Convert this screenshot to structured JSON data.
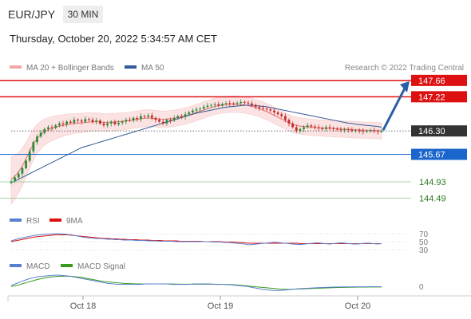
{
  "header": {
    "pair": "EUR/JPY",
    "timeframe": "30 MIN"
  },
  "datetime": "Thursday, October 20, 2022 5:34:57 AM CET",
  "legend": {
    "ma20": "MA 20 + Bollinger Bands",
    "ma50": "MA 50",
    "rsi": "RSI",
    "rsi_ma": "9MA",
    "macd": "MACD",
    "macd_signal": "MACD Signal"
  },
  "research": "Research © 2022 Trading Central",
  "colors": {
    "resistance": "#dd1111",
    "support": "#1a66cc",
    "target": "#2a7a20",
    "arrow": "#2a5fa8",
    "ma50": "#335a99",
    "ma20": "#e86f6f",
    "band_fill": "#fbe3e3",
    "rsi": "#5b7fd0",
    "rsi_ma": "#dd1111",
    "macd": "#5b7fd0",
    "macd_signal": "#3a9a20"
  },
  "chart_data": [
    {
      "type": "candlestick",
      "title": "EUR/JPY 30 MIN",
      "x_ticks": [
        "Oct 18",
        "Oct 19",
        "Oct 20"
      ],
      "ylim": [
        144.2,
        147.85
      ],
      "levels": [
        {
          "label": "147.66",
          "value": 147.66,
          "kind": "resistance"
        },
        {
          "label": "147.22",
          "value": 147.22,
          "kind": "resistance"
        },
        {
          "label": "146.30",
          "value": 146.3,
          "kind": "current"
        },
        {
          "label": "145.67",
          "value": 145.67,
          "kind": "support"
        },
        {
          "label": "144.93",
          "value": 144.93,
          "kind": "target"
        },
        {
          "label": "144.49",
          "value": 144.49,
          "kind": "target"
        }
      ],
      "close": [
        144.95,
        145.05,
        145.15,
        145.3,
        145.5,
        145.75,
        146.0,
        146.15,
        146.25,
        146.35,
        146.4,
        146.38,
        146.45,
        146.5,
        146.48,
        146.55,
        146.52,
        146.6,
        146.58,
        146.55,
        146.62,
        146.6,
        146.55,
        146.58,
        146.5,
        146.45,
        146.5,
        146.55,
        146.48,
        146.52,
        146.55,
        146.6,
        146.58,
        146.65,
        146.62,
        146.7,
        146.68,
        146.72,
        146.65,
        146.6,
        146.55,
        146.5,
        146.6,
        146.58,
        146.65,
        146.7,
        146.68,
        146.75,
        146.8,
        146.85,
        146.88,
        146.9,
        146.95,
        146.98,
        147.0,
        147.02,
        146.98,
        147.03,
        147.05,
        147.04,
        147.02,
        147.05,
        147.08,
        147.06,
        147.04,
        147.0,
        146.95,
        146.92,
        146.9,
        146.88,
        146.85,
        146.8,
        146.75,
        146.7,
        146.6,
        146.5,
        146.4,
        146.3,
        146.35,
        146.4,
        146.45,
        146.42,
        146.4,
        146.38,
        146.35,
        146.4,
        146.38,
        146.36,
        146.34,
        146.32,
        146.35,
        146.33,
        146.3,
        146.32,
        146.3,
        146.28,
        146.3,
        146.32,
        146.3,
        146.28,
        146.3
      ],
      "ma20": [
        145.0,
        145.08,
        145.2,
        145.35,
        145.55,
        145.75,
        145.95,
        146.1,
        146.2,
        146.28,
        146.33,
        146.37,
        146.4,
        146.43,
        146.45,
        146.47,
        146.49,
        146.5,
        146.51,
        146.52,
        146.53,
        146.54,
        146.54,
        146.55,
        146.54,
        146.53,
        146.53,
        146.54,
        146.54,
        146.55,
        146.56,
        146.57,
        146.58,
        146.6,
        146.61,
        146.63,
        146.64,
        146.65,
        146.64,
        146.63,
        146.62,
        146.61,
        146.62,
        146.63,
        146.64,
        146.66,
        146.68,
        146.7,
        146.73,
        146.76,
        146.8,
        146.83,
        146.86,
        146.9,
        146.93,
        146.96,
        146.98,
        147.0,
        147.01,
        147.02,
        147.02,
        147.02,
        147.01,
        147.0,
        146.98,
        146.96,
        146.93,
        146.9,
        146.86,
        146.82,
        146.77,
        146.72,
        146.67,
        146.62,
        146.57,
        146.52,
        146.48,
        146.45,
        146.43,
        146.42,
        146.41,
        146.4,
        146.39,
        146.38,
        146.38,
        146.37,
        146.37,
        146.36,
        146.36,
        146.35,
        146.35,
        146.34,
        146.34,
        146.33,
        146.33,
        146.32,
        146.32,
        146.31,
        146.31,
        146.31,
        146.3
      ],
      "ma50": [
        144.9,
        144.95,
        145.0,
        145.05,
        145.1,
        145.15,
        145.2,
        145.25,
        145.3,
        145.35,
        145.4,
        145.45,
        145.5,
        145.55,
        145.6,
        145.65,
        145.7,
        145.75,
        145.8,
        145.85,
        145.88,
        145.91,
        145.94,
        145.97,
        146.0,
        146.03,
        146.06,
        146.09,
        146.12,
        146.15,
        146.18,
        146.21,
        146.24,
        146.27,
        146.3,
        146.33,
        146.36,
        146.39,
        146.42,
        146.45,
        146.48,
        146.51,
        146.54,
        146.57,
        146.6,
        146.63,
        146.66,
        146.69,
        146.72,
        146.75,
        146.78,
        146.8,
        146.82,
        146.84,
        146.86,
        146.88,
        146.9,
        146.92,
        146.94,
        146.95,
        146.96,
        146.97,
        146.98,
        146.99,
        146.99,
        146.99,
        146.98,
        146.97,
        146.96,
        146.95,
        146.93,
        146.91,
        146.89,
        146.87,
        146.85,
        146.83,
        146.81,
        146.79,
        146.77,
        146.75,
        146.73,
        146.71,
        146.69,
        146.67,
        146.65,
        146.63,
        146.61,
        146.59,
        146.57,
        146.55,
        146.53,
        146.51,
        146.5,
        146.48,
        146.47,
        146.46,
        146.45,
        146.44,
        146.43,
        146.42,
        146.4
      ]
    },
    {
      "type": "line",
      "title": "RSI",
      "y_ticks": [
        "70",
        "50",
        "30"
      ],
      "ylim": [
        20,
        80
      ],
      "series": [
        {
          "name": "RSI",
          "values": [
            52,
            55,
            58,
            60,
            62,
            64,
            66,
            67,
            68,
            69,
            69,
            70,
            70,
            69,
            68,
            67,
            65,
            63,
            61,
            60,
            59,
            58,
            58,
            57,
            56,
            56,
            55,
            55,
            54,
            54,
            54,
            53,
            53,
            53,
            52,
            52,
            52,
            51,
            51,
            51,
            51,
            50,
            50,
            50,
            50,
            50,
            50,
            50,
            50,
            50,
            49,
            49,
            49,
            48,
            48,
            47,
            46,
            45,
            44,
            42,
            43,
            44,
            45,
            46,
            47,
            48,
            48,
            47,
            46,
            45,
            44,
            43,
            43,
            44,
            45,
            46,
            47,
            46,
            45,
            44,
            45,
            46,
            47,
            46,
            45,
            44,
            44,
            45,
            46,
            46,
            45,
            44,
            45
          ]
        },
        {
          "name": "9MA",
          "values": [
            50,
            52,
            54,
            56,
            58,
            60,
            62,
            63,
            64,
            65,
            66,
            67,
            67,
            67,
            67,
            66,
            65,
            64,
            63,
            62,
            61,
            60,
            59,
            58,
            58,
            57,
            57,
            56,
            56,
            55,
            55,
            55,
            54,
            54,
            54,
            53,
            53,
            53,
            52,
            52,
            52,
            52,
            51,
            51,
            51,
            51,
            51,
            51,
            50,
            50,
            50,
            50,
            50,
            49,
            49,
            49,
            48,
            48,
            47,
            46,
            46,
            46,
            46,
            46,
            46,
            46,
            46,
            46,
            46,
            46,
            46,
            46,
            45,
            45,
            45,
            45,
            45,
            45,
            45,
            45,
            45,
            45,
            45,
            45,
            45,
            45,
            45,
            45,
            45,
            45,
            45,
            45,
            45
          ]
        }
      ]
    },
    {
      "type": "line",
      "title": "MACD",
      "y_ticks": [
        "0"
      ],
      "ylim": [
        -0.1,
        0.15
      ],
      "series": [
        {
          "name": "MACD",
          "values": [
            0.01,
            0.03,
            0.05,
            0.07,
            0.085,
            0.095,
            0.1,
            0.105,
            0.11,
            0.11,
            0.105,
            0.1,
            0.09,
            0.08,
            0.07,
            0.06,
            0.05,
            0.04,
            0.03,
            0.025,
            0.02,
            0.02,
            0.02,
            0.02,
            0.02,
            0.025,
            0.025,
            0.025,
            0.025,
            0.025,
            0.02,
            0.02,
            0.02,
            0.02,
            0.025,
            0.025,
            0.025,
            0.025,
            0.02,
            0.02,
            0.02,
            0.015,
            0.01,
            0.005,
            0.0,
            -0.01,
            -0.02,
            -0.03,
            -0.035,
            -0.04,
            -0.04,
            -0.035,
            -0.03,
            -0.025,
            -0.02,
            -0.018,
            -0.015,
            -0.012,
            -0.01,
            -0.008,
            -0.006,
            -0.005,
            -0.004,
            -0.004,
            -0.003,
            -0.003,
            -0.003,
            -0.002,
            -0.002,
            -0.002
          ]
        },
        {
          "name": "MACD Signal",
          "values": [
            0.0,
            0.01,
            0.025,
            0.04,
            0.055,
            0.07,
            0.08,
            0.09,
            0.095,
            0.1,
            0.1,
            0.1,
            0.095,
            0.09,
            0.08,
            0.07,
            0.06,
            0.05,
            0.045,
            0.04,
            0.035,
            0.03,
            0.028,
            0.026,
            0.025,
            0.025,
            0.025,
            0.025,
            0.025,
            0.025,
            0.024,
            0.023,
            0.022,
            0.022,
            0.022,
            0.022,
            0.022,
            0.022,
            0.022,
            0.021,
            0.02,
            0.018,
            0.015,
            0.01,
            0.005,
            0.0,
            -0.005,
            -0.01,
            -0.015,
            -0.02,
            -0.025,
            -0.028,
            -0.028,
            -0.026,
            -0.024,
            -0.022,
            -0.02,
            -0.018,
            -0.016,
            -0.014,
            -0.012,
            -0.01,
            -0.009,
            -0.008,
            -0.007,
            -0.006,
            -0.006,
            -0.005,
            -0.005,
            -0.005
          ]
        }
      ]
    }
  ]
}
